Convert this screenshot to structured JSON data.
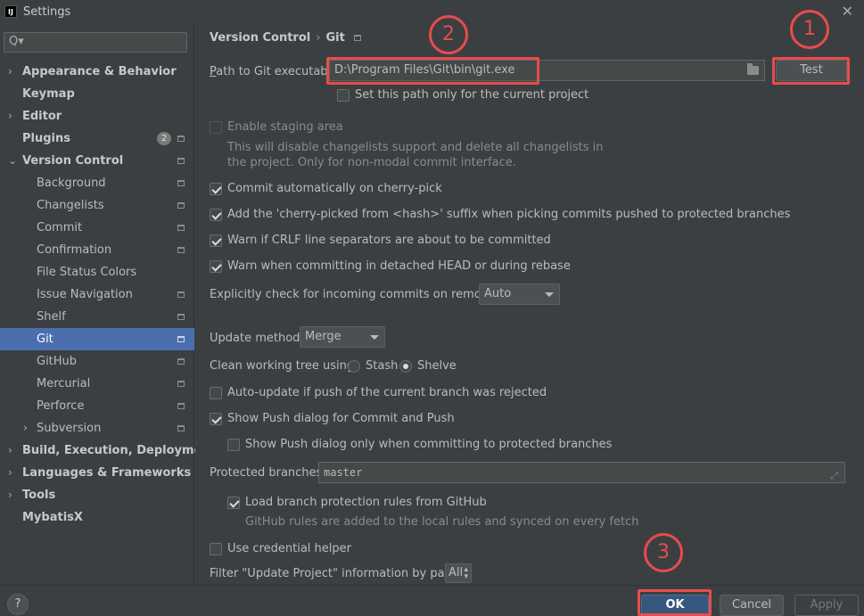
{
  "window": {
    "title": "Settings",
    "logo_text": "IJ"
  },
  "search": {
    "placeholder": "Q▾"
  },
  "sidebar": {
    "items": [
      {
        "label": "Appearance & Behavior"
      },
      {
        "label": "Keymap"
      },
      {
        "label": "Editor"
      },
      {
        "label": "Plugins",
        "badge": "2"
      },
      {
        "label": "Version Control"
      },
      {
        "label": "Background"
      },
      {
        "label": "Changelists"
      },
      {
        "label": "Commit"
      },
      {
        "label": "Confirmation"
      },
      {
        "label": "File Status Colors"
      },
      {
        "label": "Issue Navigation"
      },
      {
        "label": "Shelf"
      },
      {
        "label": "Git"
      },
      {
        "label": "GitHub"
      },
      {
        "label": "Mercurial"
      },
      {
        "label": "Perforce"
      },
      {
        "label": "Subversion"
      },
      {
        "label": "Build, Execution, Deployment"
      },
      {
        "label": "Languages & Frameworks"
      },
      {
        "label": "Tools"
      },
      {
        "label": "MybatisX"
      }
    ]
  },
  "breadcrumb": {
    "parent": "Version Control",
    "separator": "›",
    "current": "Git"
  },
  "git": {
    "path_label_first": "P",
    "path_label_rest": "ath to Git executable:",
    "path_value": "D:\\Program Files\\Git\\bin\\git.exe",
    "test_label": "Test",
    "set_path_only_label": "Set this path only for the current project",
    "enable_staging_label": "Enable staging area",
    "staging_help_1": "This will disable changelists support and delete all changelists in",
    "staging_help_2": "the project. Only for non-modal commit interface.",
    "commit_cherry_pick_label": "Commit automatically on cherry-pick",
    "add_suffix_label": "Add the 'cherry-picked from <hash>' suffix when picking commits pushed to protected branches",
    "warn_crlf_label": "Warn if CRLF line separators are about to be committed",
    "warn_detached_label": "Warn when committing in detached HEAD or during rebase",
    "explicit_check_label": "Explicitly check for incoming commits on remotes:",
    "explicit_check_value": "Auto",
    "update_method_label": "Update method:",
    "update_method_value": "Merge",
    "clean_tree_label": "Clean working tree using:",
    "stash_label": "Stash",
    "shelve_label": "Shelve",
    "auto_update_label": "Auto-update if push of the current branch was rejected",
    "show_push_label": "Show Push dialog for Commit and Push",
    "show_push_protected_label": "Show Push dialog only when committing to protected branches",
    "protected_branches_label": "Protected branches:",
    "protected_branches_value": "master",
    "load_rules_label": "Load branch protection rules from GitHub",
    "load_rules_help": "GitHub rules are added to the local rules and synced on every fetch",
    "credential_helper_label": "Use credential helper",
    "filter_label": "Filter \"Update Project\" information by paths:",
    "filter_value": "All"
  },
  "annotations": {
    "one": "1",
    "two": "2",
    "three": "3"
  },
  "footer": {
    "help": "?",
    "ok": "OK",
    "cancel": "Cancel",
    "apply": "Apply"
  },
  "colors": {
    "accent": "#4b6eaf",
    "annotation": "#e84c4c",
    "background": "#3c3f41"
  }
}
